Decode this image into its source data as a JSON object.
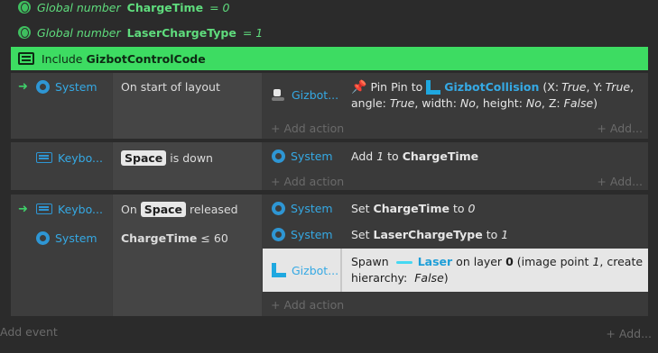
{
  "globals": [
    {
      "prefix": "Global number",
      "name": "ChargeTime",
      "suffix": "= 0"
    },
    {
      "prefix": "Global number",
      "name": "LaserChargeType",
      "suffix": "= 1"
    }
  ],
  "include": {
    "prefix": "Include",
    "name": "GizbotControlCode"
  },
  "events": [
    {
      "conditions": [
        {
          "object": "System",
          "text": "On start of layout"
        }
      ],
      "actions": [
        {
          "object": "Gizbot...",
          "pin_prefix": "Pin Pin to",
          "target": "GizbotCollision",
          "params_a": "(X:",
          "x": "True",
          "params_b": ", Y:",
          "y": "True",
          "params_c": ",",
          "line2": {
            "a": "angle:",
            "angle": "True",
            "b": ", width:",
            "width": "No",
            "c": ", height:",
            "height": "No",
            "d": ", Z:",
            "z": "False",
            "e": ")"
          }
        }
      ],
      "add_action": "Add action",
      "add": "Add..."
    },
    {
      "conditions": [
        {
          "object": "Keybo...",
          "key": "Space",
          "text": "is down"
        }
      ],
      "actions": [
        {
          "object": "System",
          "pre": "Add",
          "val": "1",
          "mid": "to",
          "name": "ChargeTime"
        }
      ],
      "add_action": "Add action",
      "add": "Add..."
    },
    {
      "conditions": [
        {
          "object": "Keybo...",
          "pre": "On",
          "key": "Space",
          "text": "released"
        },
        {
          "object": "System",
          "name": "ChargeTime",
          "text": "≤ 60"
        }
      ],
      "actions": [
        {
          "object": "System",
          "pre": "Set",
          "name": "ChargeTime",
          "mid": "to",
          "val": "0"
        },
        {
          "object": "System",
          "pre": "Set",
          "name": "LaserChargeType",
          "mid": "to",
          "val": "1"
        },
        {
          "object": "Gizbot...",
          "pre": "Spawn",
          "target": "Laser",
          "mid": "on layer",
          "layer": "0",
          "rest1": "(image point",
          "point": "1",
          "rest2": ", create",
          "line2": {
            "a": "hierarchy:",
            "b": "False",
            "c": ")"
          }
        }
      ],
      "add_action": "Add action"
    }
  ],
  "footer": {
    "add_event": "Add event",
    "add": "Add..."
  }
}
